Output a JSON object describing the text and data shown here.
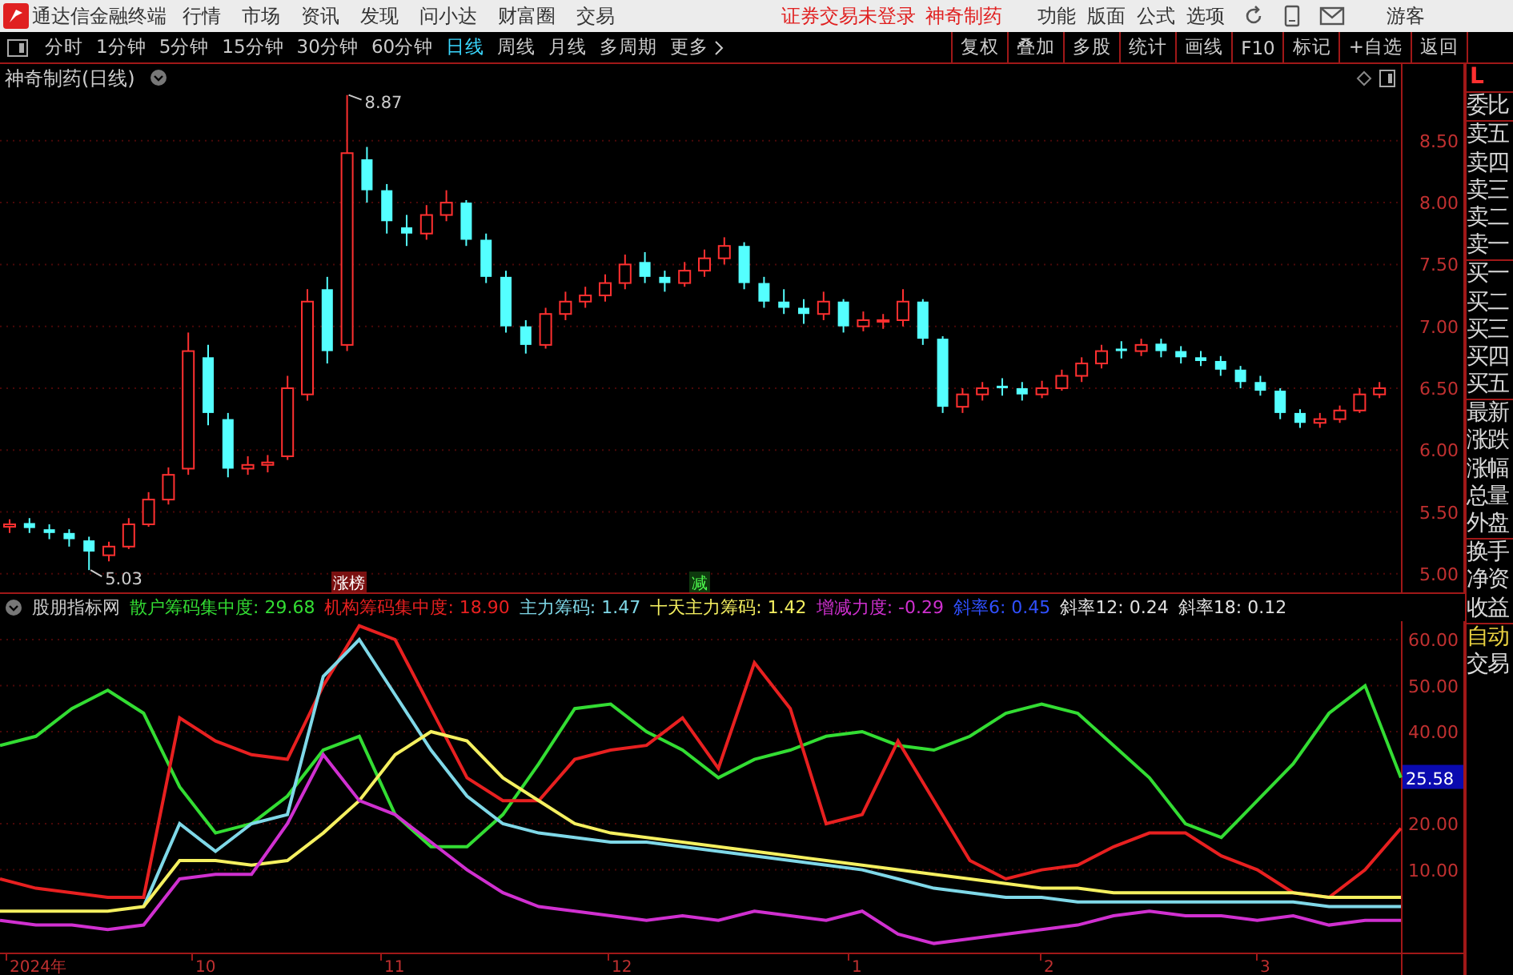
{
  "menu_bar": {
    "app_title": "通达信金融终端",
    "menus": [
      "行情",
      "市场",
      "资讯",
      "发现",
      "问小达",
      "财富圈",
      "交易"
    ],
    "notice": "证券交易未登录",
    "stock_name": "神奇制药",
    "tools": [
      "功能",
      "版面",
      "公式",
      "选项"
    ],
    "user": "游客"
  },
  "toolbar": {
    "periods": [
      {
        "label": "分时",
        "selected": false
      },
      {
        "label": "1分钟",
        "selected": false
      },
      {
        "label": "5分钟",
        "selected": false
      },
      {
        "label": "15分钟",
        "selected": false
      },
      {
        "label": "30分钟",
        "selected": false
      },
      {
        "label": "60分钟",
        "selected": false
      },
      {
        "label": "日线",
        "selected": true
      },
      {
        "label": "周线",
        "selected": false
      },
      {
        "label": "月线",
        "selected": false
      },
      {
        "label": "多周期",
        "selected": false
      }
    ],
    "more": "更多",
    "actions": [
      "复权",
      "叠加",
      "多股",
      "统计",
      "画线",
      "F10",
      "标记",
      "+自选",
      "返回"
    ]
  },
  "price_chart": {
    "title": "神奇制药(日线)",
    "high_label": "8.87",
    "low_label": "5.03",
    "markers": [
      {
        "label": "涨榜",
        "kind": "rank"
      },
      {
        "label": "减",
        "kind": "reduce"
      }
    ],
    "chart_data": {
      "type": "candlestick",
      "ylim": [
        4.85,
        9.12
      ],
      "yticks": [
        {
          "value": 8.5,
          "label": "8.50"
        },
        {
          "value": 8,
          "label": "8.00"
        },
        {
          "value": 7.5,
          "label": "7.50"
        },
        {
          "value": 7,
          "label": "7.00"
        },
        {
          "value": 6.5,
          "label": "6.50"
        },
        {
          "value": 6,
          "label": "6.00"
        },
        {
          "value": 5.5,
          "label": "5.50"
        },
        {
          "value": 5,
          "label": "5.00"
        }
      ],
      "grid": true,
      "ohlc": [
        [
          5.38,
          5.44,
          5.33,
          5.4
        ],
        [
          5.41,
          5.45,
          5.33,
          5.37
        ],
        [
          5.36,
          5.4,
          5.28,
          5.33
        ],
        [
          5.33,
          5.36,
          5.22,
          5.28
        ],
        [
          5.27,
          5.3,
          5.03,
          5.18
        ],
        [
          5.15,
          5.26,
          5.1,
          5.22
        ],
        [
          5.22,
          5.45,
          5.2,
          5.4
        ],
        [
          5.4,
          5.66,
          5.38,
          5.6
        ],
        [
          5.6,
          5.86,
          5.56,
          5.8
        ],
        [
          5.85,
          6.95,
          5.8,
          6.8
        ],
        [
          6.75,
          6.85,
          6.2,
          6.3
        ],
        [
          6.25,
          6.3,
          5.78,
          5.85
        ],
        [
          5.85,
          5.95,
          5.8,
          5.88
        ],
        [
          5.88,
          5.96,
          5.82,
          5.9
        ],
        [
          5.95,
          6.6,
          5.92,
          6.5
        ],
        [
          6.45,
          7.3,
          6.4,
          7.2
        ],
        [
          7.3,
          7.4,
          6.7,
          6.8
        ],
        [
          6.85,
          8.87,
          6.8,
          8.4
        ],
        [
          8.35,
          8.45,
          8.0,
          8.1
        ],
        [
          8.1,
          8.15,
          7.75,
          7.85
        ],
        [
          7.8,
          7.9,
          7.65,
          7.75
        ],
        [
          7.75,
          7.98,
          7.7,
          7.9
        ],
        [
          7.9,
          8.1,
          7.85,
          8.0
        ],
        [
          8.0,
          8.02,
          7.65,
          7.7
        ],
        [
          7.7,
          7.75,
          7.35,
          7.4
        ],
        [
          7.4,
          7.45,
          6.95,
          7.0
        ],
        [
          7.0,
          7.05,
          6.78,
          6.85
        ],
        [
          6.85,
          7.15,
          6.82,
          7.1
        ],
        [
          7.1,
          7.28,
          7.05,
          7.2
        ],
        [
          7.2,
          7.32,
          7.15,
          7.25
        ],
        [
          7.25,
          7.42,
          7.2,
          7.35
        ],
        [
          7.35,
          7.58,
          7.3,
          7.5
        ],
        [
          7.52,
          7.6,
          7.35,
          7.4
        ],
        [
          7.4,
          7.45,
          7.28,
          7.35
        ],
        [
          7.35,
          7.52,
          7.32,
          7.45
        ],
        [
          7.45,
          7.62,
          7.4,
          7.55
        ],
        [
          7.55,
          7.72,
          7.5,
          7.65
        ],
        [
          7.65,
          7.68,
          7.3,
          7.35
        ],
        [
          7.35,
          7.4,
          7.15,
          7.2
        ],
        [
          7.2,
          7.3,
          7.1,
          7.15
        ],
        [
          7.15,
          7.22,
          7.02,
          7.1
        ],
        [
          7.1,
          7.28,
          7.05,
          7.2
        ],
        [
          7.2,
          7.22,
          6.95,
          7.0
        ],
        [
          7.0,
          7.12,
          6.96,
          7.05
        ],
        [
          7.05,
          7.1,
          6.98,
          7.05
        ],
        [
          7.05,
          7.3,
          7.0,
          7.2
        ],
        [
          7.2,
          7.22,
          6.85,
          6.9
        ],
        [
          6.9,
          6.92,
          6.3,
          6.35
        ],
        [
          6.35,
          6.5,
          6.3,
          6.45
        ],
        [
          6.45,
          6.55,
          6.4,
          6.5
        ],
        [
          6.52,
          6.58,
          6.44,
          6.5
        ],
        [
          6.5,
          6.55,
          6.4,
          6.45
        ],
        [
          6.45,
          6.56,
          6.42,
          6.5
        ],
        [
          6.5,
          6.65,
          6.48,
          6.6
        ],
        [
          6.6,
          6.75,
          6.55,
          6.7
        ],
        [
          6.7,
          6.85,
          6.66,
          6.8
        ],
        [
          6.82,
          6.88,
          6.74,
          6.8
        ],
        [
          6.8,
          6.9,
          6.76,
          6.85
        ],
        [
          6.86,
          6.9,
          6.75,
          6.8
        ],
        [
          6.8,
          6.84,
          6.7,
          6.75
        ],
        [
          6.75,
          6.8,
          6.68,
          6.72
        ],
        [
          6.72,
          6.76,
          6.6,
          6.65
        ],
        [
          6.65,
          6.68,
          6.5,
          6.55
        ],
        [
          6.55,
          6.6,
          6.44,
          6.48
        ],
        [
          6.48,
          6.5,
          6.25,
          6.3
        ],
        [
          6.3,
          6.33,
          6.18,
          6.22
        ],
        [
          6.22,
          6.3,
          6.18,
          6.25
        ],
        [
          6.25,
          6.36,
          6.22,
          6.32
        ],
        [
          6.32,
          6.5,
          6.3,
          6.45
        ],
        [
          6.45,
          6.55,
          6.42,
          6.5
        ]
      ]
    }
  },
  "indicator": {
    "name": "股朋指标网",
    "series_readouts": [
      ": 29.68",
      ": 18.90",
      ": 1.47",
      ": 1.42",
      ": -0.29"
    ],
    "extra_readouts": [
      {
        "label": "斜率6: 0.45",
        "color": "#3050ff"
      },
      {
        "label": "斜率12: 0.24",
        "color": "#e0e0e0"
      },
      {
        "label": "斜率18: 0.12",
        "color": "#e0e0e0"
      }
    ],
    "current_value": "25.58",
    "chart_data": {
      "type": "line",
      "ylim": [
        -8,
        64
      ],
      "grid": true,
      "yticks": [
        {
          "value": 10,
          "label": "10.00"
        },
        {
          "value": 20,
          "label": "20.00"
        },
        {
          "value": 40,
          "label": "40.00"
        },
        {
          "value": 50,
          "label": "50.00"
        },
        {
          "value": 60,
          "label": "60.00"
        }
      ],
      "series": [
        {
          "name": "散户筹码集中度",
          "color": "#33dd33",
          "values": [
            37,
            39,
            45,
            49,
            44,
            28,
            18,
            20,
            26,
            36,
            39,
            22,
            15,
            15,
            22,
            33,
            45,
            46,
            40,
            36,
            30,
            34,
            36,
            39,
            40,
            37,
            36,
            39,
            44,
            46,
            44,
            37,
            30,
            20,
            17,
            25,
            33,
            44,
            50,
            30
          ]
        },
        {
          "name": "机构筹码集中度",
          "color": "#e82020",
          "values": [
            8,
            6,
            5,
            4,
            4,
            43,
            38,
            35,
            34,
            50,
            63,
            60,
            45,
            30,
            25,
            25,
            34,
            36,
            37,
            43,
            32,
            55,
            45,
            20,
            22,
            38,
            25,
            12,
            8,
            10,
            11,
            15,
            18,
            18,
            13,
            10,
            5,
            4,
            10,
            19
          ]
        },
        {
          "name": "主力筹码",
          "color": "#7fd8e8",
          "values": [
            null,
            null,
            null,
            null,
            2,
            20,
            14,
            20,
            22,
            52,
            60,
            48,
            36,
            26,
            20,
            18,
            17,
            16,
            16,
            15,
            14,
            13,
            12,
            11,
            10,
            8,
            6,
            5,
            4,
            4,
            3,
            3,
            3,
            3,
            3,
            3,
            3,
            2,
            2,
            2
          ]
        },
        {
          "name": "十天主力筹码",
          "color": "#f5f060",
          "values": [
            1,
            1,
            1,
            1,
            2,
            12,
            12,
            11,
            12,
            18,
            25,
            35,
            40,
            38,
            30,
            25,
            20,
            18,
            17,
            16,
            15,
            14,
            13,
            12,
            11,
            10,
            9,
            8,
            7,
            6,
            6,
            5,
            5,
            5,
            5,
            5,
            5,
            4,
            4,
            4
          ]
        },
        {
          "name": "增减力度",
          "color": "#d030d0",
          "values": [
            -1,
            -2,
            -2,
            -3,
            -2,
            8,
            9,
            9,
            20,
            35,
            25,
            22,
            16,
            10,
            5,
            2,
            1,
            0,
            -1,
            0,
            -1,
            1,
            0,
            -1,
            1,
            -4,
            -6,
            -5,
            -4,
            -3,
            -2,
            0,
            1,
            0,
            0,
            -1,
            0,
            -2,
            -1,
            -1
          ]
        }
      ]
    }
  },
  "date_axis": [
    "2024年",
    "10",
    "11",
    "12",
    "1",
    "2",
    "3"
  ],
  "sidebar": {
    "mode": "L",
    "groups": [
      [
        "委比"
      ],
      [
        "卖五",
        "卖四",
        "卖三",
        "卖二",
        "卖一"
      ],
      [
        "买一",
        "买二",
        "买三",
        "买四",
        "买五"
      ],
      [
        "最新",
        "涨跌",
        "涨幅",
        "总量",
        "外盘"
      ],
      [
        "换手",
        "净资",
        "收益"
      ]
    ],
    "tabs": [
      {
        "label": "自动",
        "selected": true
      },
      {
        "label": "交易",
        "selected": false
      }
    ]
  }
}
